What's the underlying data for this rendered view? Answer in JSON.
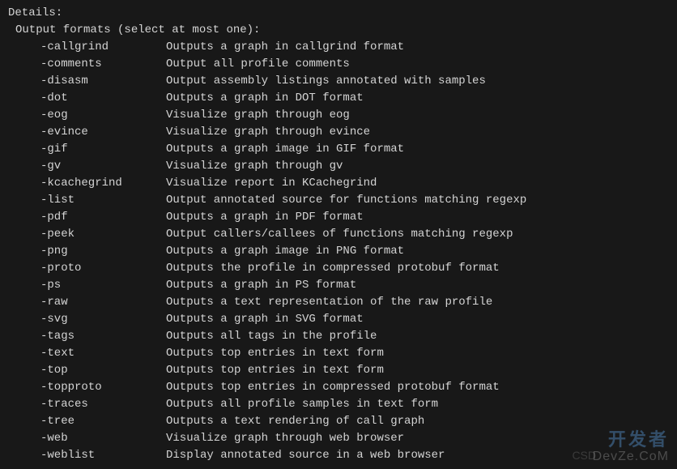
{
  "header": {
    "title": "Details:",
    "subtitle": "Output formats (select at most one):"
  },
  "flags": [
    {
      "name": "-callgrind",
      "desc": "Outputs a graph in callgrind format"
    },
    {
      "name": "-comments",
      "desc": "Output all profile comments"
    },
    {
      "name": "-disasm",
      "desc": "Output assembly listings annotated with samples"
    },
    {
      "name": "-dot",
      "desc": "Outputs a graph in DOT format"
    },
    {
      "name": "-eog",
      "desc": "Visualize graph through eog"
    },
    {
      "name": "-evince",
      "desc": "Visualize graph through evince"
    },
    {
      "name": "-gif",
      "desc": "Outputs a graph image in GIF format"
    },
    {
      "name": "-gv",
      "desc": "Visualize graph through gv"
    },
    {
      "name": "-kcachegrind",
      "desc": "Visualize report in KCachegrind"
    },
    {
      "name": "-list",
      "desc": "Output annotated source for functions matching regexp"
    },
    {
      "name": "-pdf",
      "desc": "Outputs a graph in PDF format"
    },
    {
      "name": "-peek",
      "desc": "Output callers/callees of functions matching regexp"
    },
    {
      "name": "-png",
      "desc": "Outputs a graph image in PNG format"
    },
    {
      "name": "-proto",
      "desc": "Outputs the profile in compressed protobuf format"
    },
    {
      "name": "-ps",
      "desc": "Outputs a graph in PS format"
    },
    {
      "name": "-raw",
      "desc": "Outputs a text representation of the raw profile"
    },
    {
      "name": "-svg",
      "desc": "Outputs a graph in SVG format"
    },
    {
      "name": "-tags",
      "desc": "Outputs all tags in the profile"
    },
    {
      "name": "-text",
      "desc": "Outputs top entries in text form"
    },
    {
      "name": "-top",
      "desc": "Outputs top entries in text form"
    },
    {
      "name": "-topproto",
      "desc": "Outputs top entries in compressed protobuf format"
    },
    {
      "name": "-traces",
      "desc": "Outputs all profile samples in text form"
    },
    {
      "name": "-tree",
      "desc": "Outputs a text rendering of call graph"
    },
    {
      "name": "-web",
      "desc": "Visualize graph through web browser"
    },
    {
      "name": "-weblist",
      "desc": "Display annotated source in a web browser"
    }
  ],
  "watermark": {
    "line1": "开发者",
    "line2": "DevZe.CoM",
    "csdn": "CSD"
  }
}
